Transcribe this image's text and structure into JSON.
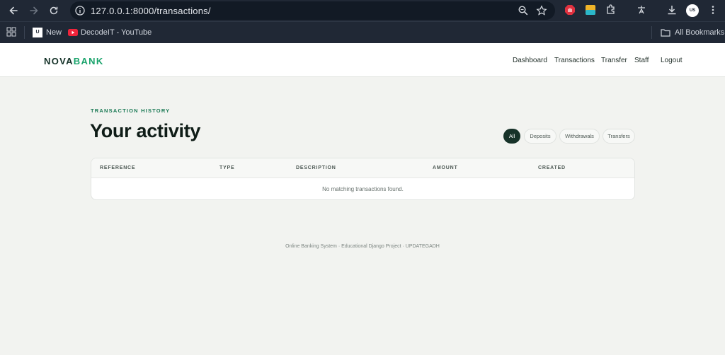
{
  "browser": {
    "url": "127.0.0.1:8000/transactions/",
    "profile_initials": "US",
    "bookmarks": [
      {
        "label": "New"
      },
      {
        "label": "DecodeIT - YouTube"
      }
    ],
    "all_bookmarks_label": "All Bookmarks"
  },
  "site": {
    "brand_left": "NOVA",
    "brand_right": "BANK",
    "brand_accent_color": "#19a36b",
    "nav": [
      {
        "label": "Dashboard"
      },
      {
        "label": "Transactions"
      },
      {
        "label": "Transfer"
      },
      {
        "label": "Staff"
      },
      {
        "label": "Logout"
      }
    ]
  },
  "page": {
    "eyebrow": "TRANSACTION HISTORY",
    "title": "Your activity",
    "filters": [
      {
        "label": "All",
        "active": true
      },
      {
        "label": "Deposits",
        "active": false
      },
      {
        "label": "Withdrawals",
        "active": false
      },
      {
        "label": "Transfers",
        "active": false
      }
    ],
    "table": {
      "columns": [
        "REFERENCE",
        "TYPE",
        "DESCRIPTION",
        "AMOUNT",
        "CREATED"
      ],
      "empty_message": "No matching transactions found."
    },
    "footer": "Online Banking System · Educational Django Project · UPDATEGADH"
  }
}
